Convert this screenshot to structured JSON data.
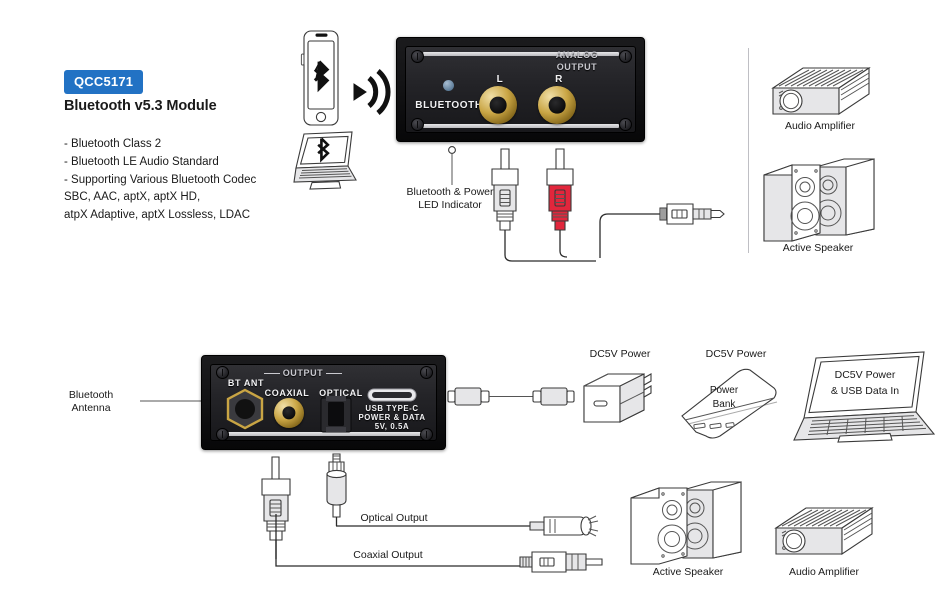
{
  "product": {
    "badge": "QCC5171",
    "title": "Bluetooth v5.3 Module",
    "features": "- Bluetooth Class 2\n- Bluetooth LE Audio Standard\n- Supporting Various Bluetooth Codec\n  SBC, AAC, aptX, aptX HD,\n  atpX Adaptive, aptX Lossless, LDAC"
  },
  "colors": {
    "badge_blue": "#2272c4",
    "rca_gold": "#c9a544",
    "rca_red": "#e2263c",
    "panel_dark": "#18181b"
  },
  "front_panel": {
    "bluetooth_label": "BLUETOOTH",
    "analog_label": "ANALOG",
    "output_label": "OUTPUT",
    "jack_left": "L",
    "jack_right": "R"
  },
  "rear_panel": {
    "antenna_label": "BT ANT",
    "output_label": "OUTPUT",
    "coaxial_label": "COAXIAL",
    "optical_label": "OPTICAL",
    "usb_line1": "USB TYPE-C",
    "usb_line2": "POWER & DATA",
    "usb_line3": "5V, 0.5A"
  },
  "callouts": {
    "led_indicator": "Bluetooth & Power\nLED Indicator",
    "analog_output": "Analog Output",
    "bluetooth_antenna": "Bluetooth\nAntenna",
    "optical_output": "Optical Output",
    "coaxial_output": "Coaxial Output"
  },
  "sources": {
    "phone_icon": "bluetooth-glyph",
    "laptop_icon": "bluetooth-glyph",
    "wireless_icon": "bluetooth-waves"
  },
  "top_devices": [
    {
      "label": "Audio Amplifier",
      "icon": "amplifier"
    },
    {
      "label": "Active Speaker",
      "icon": "speaker-pair"
    }
  ],
  "power_devices": [
    {
      "label": "DC5V Power",
      "icon": "wall-adapter"
    },
    {
      "label": "DC5V Power",
      "icon": "power-bank",
      "caption": "Power\nBank"
    },
    {
      "label": "",
      "icon": "laptop",
      "screen_text": "DC5V Power\n& USB Data In"
    }
  ],
  "bottom_devices": [
    {
      "label": "Active Speaker",
      "icon": "speaker-pair"
    },
    {
      "label": "Audio Amplifier",
      "icon": "amplifier"
    }
  ]
}
